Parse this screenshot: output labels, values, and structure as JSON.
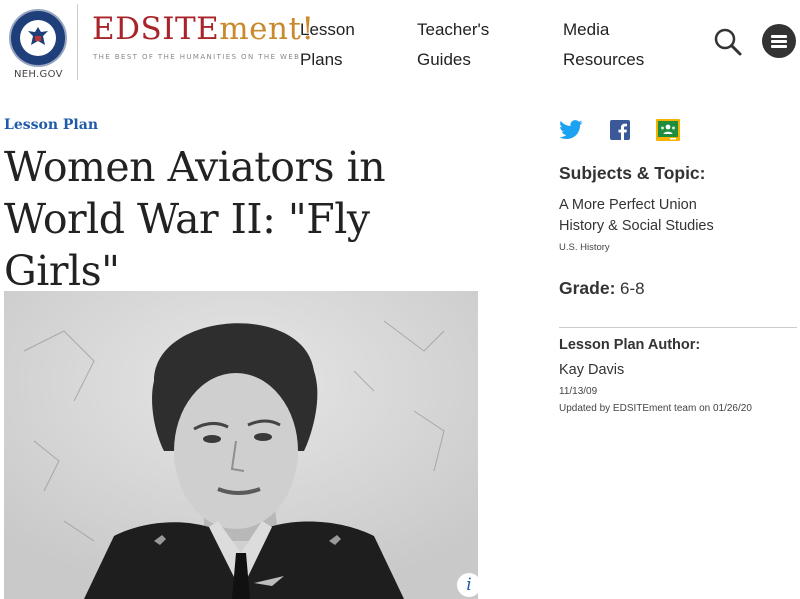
{
  "header": {
    "seal_label": "NEH.GOV",
    "brand_main": "EDSITE",
    "brand_accent": "ment!",
    "tagline": "THE BEST OF THE HUMANITIES ON THE WEB",
    "nav": [
      {
        "line1": "Lesson",
        "line2": "Plans"
      },
      {
        "line1": "Teacher's",
        "line2": "Guides"
      },
      {
        "line1": "Media",
        "line2": "Resources"
      }
    ]
  },
  "main": {
    "category": "Lesson Plan",
    "title": "Women Aviators in World War II: \"Fly Girls\"",
    "photo_info": "i"
  },
  "sidebar": {
    "subjects_heading": "Subjects & Topic:",
    "subjects": [
      "A More Perfect Union",
      "History & Social Studies"
    ],
    "subtopic": "U.S. History",
    "grade_label": "Grade:",
    "grade_value": "6-8",
    "author_heading": "Lesson Plan Author:",
    "author": "Kay Davis",
    "date": "11/13/09",
    "updated": "Updated by EDSITEment team on 01/26/20"
  },
  "colors": {
    "brand_red": "#a8232a",
    "brand_gold": "#c98a2e",
    "link_blue": "#1e5aa8",
    "twitter": "#1da1f2",
    "facebook": "#3b5998",
    "classroom": "#1e8e3e"
  },
  "icons": [
    "neh-seal-icon",
    "search-icon",
    "menu-icon",
    "twitter-icon",
    "facebook-icon",
    "google-classroom-icon",
    "info-icon"
  ]
}
